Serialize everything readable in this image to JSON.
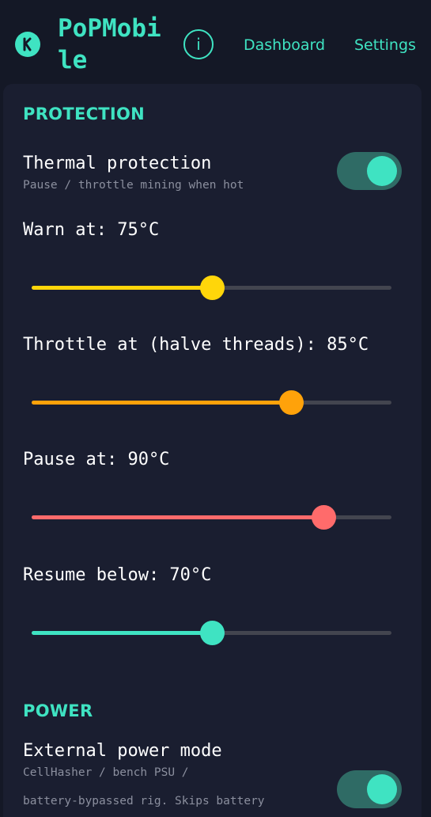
{
  "header": {
    "app_title": "PoPMobile",
    "info_label": "i",
    "nav": [
      {
        "label": "Dashboard"
      },
      {
        "label": "Settings"
      }
    ]
  },
  "protection": {
    "heading": "PROTECTION",
    "thermal": {
      "title": "Thermal protection",
      "subtitle": "Pause / throttle mining when hot",
      "enabled": true
    },
    "sliders": [
      {
        "label": "Warn at: 75°C",
        "fraction": 0.5,
        "color": "#ffd60a"
      },
      {
        "label": "Throttle at (halve threads): 85°C",
        "fraction": 0.72,
        "color": "#ffa20a"
      },
      {
        "label": "Pause at: 90°C",
        "fraction": 0.81,
        "color": "#ff6b6b"
      },
      {
        "label": "Resume below: 70°C",
        "fraction": 0.5,
        "color": "#3fe3c2"
      }
    ]
  },
  "power": {
    "heading": "POWER",
    "external": {
      "title": "External power mode",
      "subtitle_line1": "CellHasher / bench PSU /",
      "subtitle_line2": "battery-bypassed rig. Skips battery",
      "enabled": true
    }
  },
  "colors": {
    "accent": "#3fe3c2",
    "background": "#141826",
    "panel": "#1a1e30",
    "toggle_track": "#2f6b65",
    "slider_track": "#43454f"
  },
  "icons": {
    "logo": "k-logo-icon"
  }
}
